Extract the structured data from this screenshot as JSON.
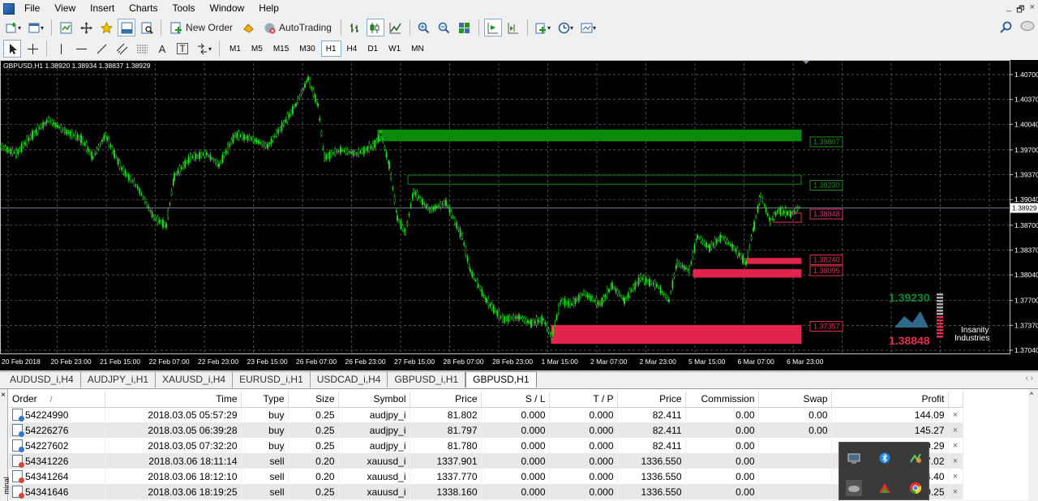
{
  "menu": [
    "File",
    "View",
    "Insert",
    "Charts",
    "Tools",
    "Window",
    "Help"
  ],
  "window_controls": [
    "_",
    "🗗",
    "×"
  ],
  "toolbar": {
    "new_order": "New Order",
    "auto_trading": "AutoTrading",
    "line_label": "A",
    "text_label": "T"
  },
  "timeframes": [
    "M1",
    "M5",
    "M15",
    "M30",
    "H1",
    "H4",
    "D1",
    "W1",
    "MN"
  ],
  "active_timeframe": "H1",
  "chart": {
    "header": "GBPUSD,H1  1.38920 1.38934 1.38837 1.38929",
    "price_labels": [
      "1.40700",
      "1.40370",
      "1.40040",
      "1.39700",
      "1.39370",
      "1.39040",
      "1.38700",
      "1.38370",
      "1.38040",
      "1.37700",
      "1.37370",
      "1.37040"
    ],
    "current_price": "1.38929",
    "time_labels": [
      "20 Feb 2018",
      "20 Feb 23:00",
      "21 Feb 15:00",
      "22 Feb 07:00",
      "22 Feb 23:00",
      "23 Feb 15:00",
      "26 Feb 07:00",
      "26 Feb 23:00",
      "27 Feb 15:00",
      "28 Feb 07:00",
      "28 Feb 23:00",
      "1 Mar 15:00",
      "2 Mar 07:00",
      "2 Mar 23:00",
      "5 Mar 15:00",
      "6 Mar 07:00",
      "6 Mar 23:00"
    ],
    "zones": [
      {
        "label": "1.39807",
        "color": "#1a8f1a",
        "kind": "supply-strong"
      },
      {
        "label": "1.39230",
        "color": "#1a8f1a",
        "kind": "supply-weak"
      },
      {
        "label": "1.38848",
        "color": "#e2306f",
        "kind": "demand-weak"
      },
      {
        "label": "1.38240",
        "color": "#e2304a",
        "kind": "demand"
      },
      {
        "label": "1.38095",
        "color": "#e2304a",
        "kind": "demand"
      },
      {
        "label": "1.37357",
        "color": "#e2304a",
        "kind": "demand-strong"
      }
    ],
    "indicator_upper": "1.39230",
    "indicator_lower": "1.38848",
    "brand_line1": "Insanity",
    "brand_line2": "Industries",
    "colors": {
      "background": "#000000",
      "candles": "#22dd22",
      "grid": "#6a6a6a",
      "supply": "#0c8a0c",
      "demand": "#e2234e"
    }
  },
  "symbol_tabs": [
    "AUDUSD_i,H4",
    "AUDJPY_i,H1",
    "XAUUSD_i,H4",
    "EURUSD_i,H1",
    "USDCAD_i,H4",
    "GBPUSD_i,H1",
    "GBPUSD,H1"
  ],
  "active_symbol_tab": "GBPUSD,H1",
  "terminal": {
    "side_label": "minal",
    "columns": [
      "Order",
      "Time",
      "Type",
      "Size",
      "Symbol",
      "Price",
      "S / L",
      "T / P",
      "Price",
      "Commission",
      "Swap",
      "Profit"
    ],
    "sort_indicator": "/",
    "rows": [
      {
        "order": "54224990",
        "time": "2018.03.05 05:57:29",
        "type": "buy",
        "size": "0.25",
        "symbol": "audjpy_i",
        "price": "81.802",
        "sl": "0.000",
        "tp": "0.000",
        "cur": "82.411",
        "commission": "0.00",
        "swap": "0.00",
        "profit": "144.09"
      },
      {
        "order": "54226276",
        "time": "2018.03.05 06:39:28",
        "type": "buy",
        "size": "0.25",
        "symbol": "audjpy_i",
        "price": "81.797",
        "sl": "0.000",
        "tp": "0.000",
        "cur": "82.411",
        "commission": "0.00",
        "swap": "0.00",
        "profit": "145.27"
      },
      {
        "order": "54227602",
        "time": "2018.03.05 07:32:20",
        "type": "buy",
        "size": "0.25",
        "symbol": "audjpy_i",
        "price": "81.780",
        "sl": "0.000",
        "tp": "0.000",
        "cur": "82.411",
        "commission": "0.00",
        "swap": "",
        "profit": "149.29"
      },
      {
        "order": "54341226",
        "time": "2018.03.06 18:11:14",
        "type": "sell",
        "size": "0.20",
        "symbol": "xauusd_i",
        "price": "1337.901",
        "sl": "0.000",
        "tp": "0.000",
        "cur": "1336.550",
        "commission": "0.00",
        "swap": "",
        "profit": "27.02"
      },
      {
        "order": "54341264",
        "time": "2018.03.06 18:12:10",
        "type": "sell",
        "size": "0.20",
        "symbol": "xauusd_i",
        "price": "1337.770",
        "sl": "0.000",
        "tp": "0.000",
        "cur": "1336.550",
        "commission": "0.00",
        "swap": "",
        "profit": "24.40"
      },
      {
        "order": "54341646",
        "time": "2018.03.06 18:19:25",
        "type": "sell",
        "size": "0.25",
        "symbol": "xauusd_i",
        "price": "1338.160",
        "sl": "0.000",
        "tp": "0.000",
        "cur": "1336.550",
        "commission": "0.00",
        "swap": "",
        "profit": "40.25"
      }
    ]
  },
  "tray": {
    "icons": [
      "display-icon",
      "bluetooth-icon",
      "network-icon",
      "onedrive-icon",
      "antivirus-icon",
      "chrome-icon"
    ]
  }
}
